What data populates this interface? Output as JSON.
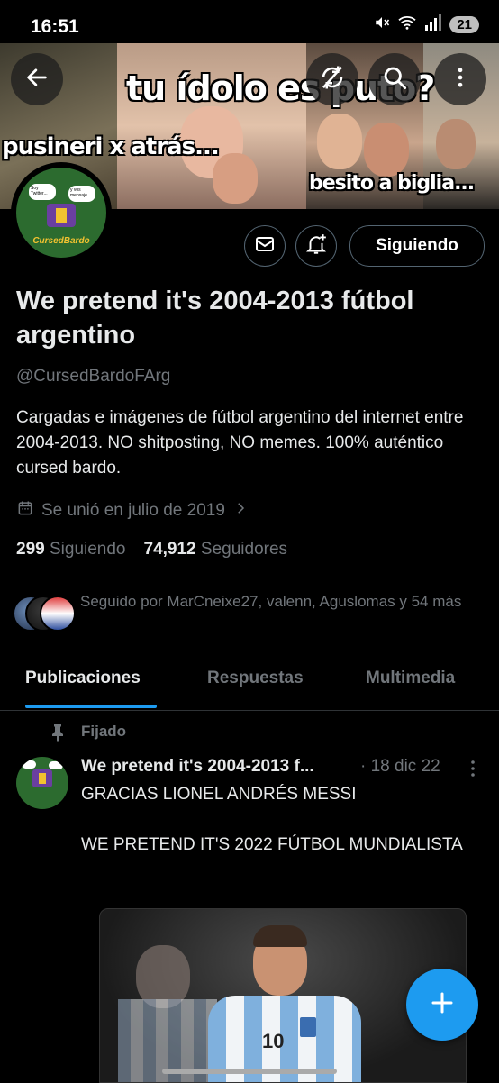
{
  "status_bar": {
    "time": "16:51",
    "battery": "21"
  },
  "banner": {
    "texts": [
      "tu ídolo es puto?",
      "pusineri x atrás...",
      "besito a biglia..."
    ]
  },
  "header_actions": {
    "back_icon": "arrow-left-icon",
    "sync_icon": "sync-off-icon",
    "search_icon": "search-icon",
    "more_icon": "more-vertical-icon"
  },
  "avatar": {
    "brand_text": "CursedBardo",
    "bubble_left": "Soy Twitter...",
    "bubble_right": "y vos mensaje..."
  },
  "profile_actions": {
    "follow_label": "Siguiendo",
    "message_icon": "mail-icon",
    "notify_icon": "bell-plus-icon"
  },
  "profile": {
    "name": "We pretend it's 2004-2013 fútbol argentino",
    "handle": "@CursedBardoFArg",
    "bio": "Cargadas e imágenes de fútbol argentino del internet entre 2004-2013.  NO shitposting, NO memes. 100% auténtico cursed bardo.",
    "joined": "Se unió en julio de 2019",
    "following_count": "299",
    "following_label": "Siguiendo",
    "followers_count": "74,912",
    "followers_label": "Seguidores",
    "followed_by": "Seguido por MarCneixe27, valenn, Aguslomas y 54 más"
  },
  "tabs": [
    {
      "label": "Publicaciones",
      "active": true
    },
    {
      "label": "Respuestas",
      "active": false
    },
    {
      "label": "Multimedia",
      "active": false
    }
  ],
  "post": {
    "pinned_label": "Fijado",
    "author": "We pretend it's 2004-2013 f...",
    "date": "· 18 dic 22",
    "text": "GRACIAS LIONEL ANDRÉS MESSI\n\nWE PRETEND IT'S 2022 FÚTBOL MUNDIALISTA",
    "jersey_number": "10"
  },
  "colors": {
    "accent": "#1d9bf0",
    "muted": "#71767b",
    "text": "#e7e9ea"
  }
}
